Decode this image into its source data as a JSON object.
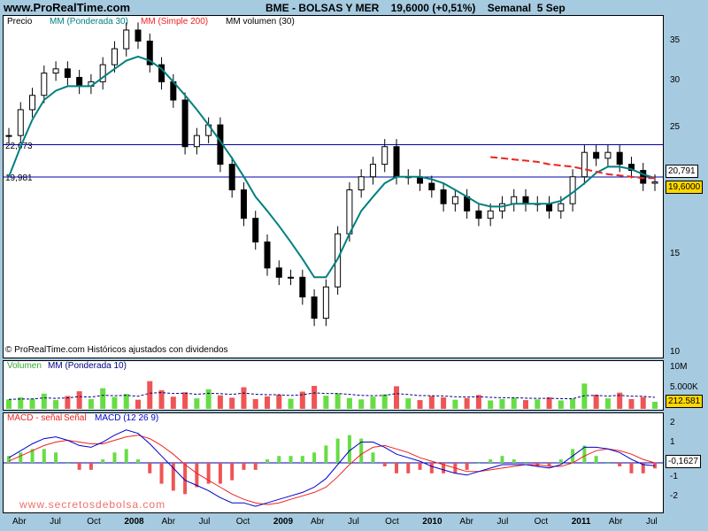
{
  "site": "www.ProRealTime.com",
  "header": {
    "instrument": "BME - BOLSAS Y MER",
    "price": "19,6000",
    "change": "(+0,51%)",
    "period": "Semanal  5 Sep"
  },
  "colors": {
    "background": "#a6cae0",
    "wma30": "#008080",
    "sma200": "#ee2222",
    "volume_up": "#66dd44",
    "volume_down": "#ee5555",
    "volume_ma": "#000080",
    "macd": "#0000cc",
    "signal": "#ee2222",
    "hline": "#0000aa"
  },
  "price_panel": {
    "legend": {
      "price": "Precio",
      "wma": "MM (Ponderada 30)",
      "sma": "MM (Simple 200)",
      "volma": "MM volumen (30)"
    },
    "copyright": "© ProRealTime.com Históricos ajustados con dividendos",
    "hlines": [
      {
        "label": "22,673",
        "value": 22.673
      },
      {
        "label": "19,981",
        "value": 19.981
      }
    ],
    "right_tags": {
      "ma": "20,791",
      "last": "19,6000"
    },
    "y_ticks": [
      "35",
      "30",
      "25",
      "20",
      "15",
      "10"
    ]
  },
  "volume_panel": {
    "legend_a": "Volumen",
    "legend_b": "MM (Ponderada 10)",
    "y_ticks": [
      "10M",
      "5.000K"
    ],
    "last_tag": "212.581"
  },
  "macd_panel": {
    "legend_a": "MACD - señal",
    "legend_b": "Señal",
    "legend_c": "MACD (12 26 9)",
    "y_ticks": [
      "2",
      "1",
      "-1",
      "-2"
    ],
    "zero_tick": "0",
    "last_tag": "-0,1627",
    "watermark": "www.secretosdebolsa.com"
  },
  "x_axis": [
    "Abr",
    "Jul",
    "Oct",
    "2008",
    "Abr",
    "Jul",
    "Oct",
    "2009",
    "Abr",
    "Jul",
    "Oct",
    "2010",
    "Abr",
    "Jul",
    "Oct",
    "2011",
    "Abr",
    "Jul"
  ],
  "chart_data": [
    {
      "type": "line",
      "series": [
        {
          "name": "Precio",
          "values": [
            23.5,
            26,
            27.5,
            30,
            30.5,
            29.5,
            28.5,
            29,
            31,
            33,
            35.5,
            34,
            31,
            29,
            27,
            22.5,
            23.5,
            24.5,
            21,
            19,
            17,
            15.5,
            14,
            13.5,
            13.5,
            12.5,
            11.5,
            13,
            16,
            19,
            20,
            21,
            22.5,
            20,
            20,
            19.5,
            19,
            18,
            18.5,
            17.5,
            17,
            17.5,
            18,
            18.5,
            18,
            18,
            17.5,
            18,
            20,
            22,
            21.5,
            22,
            21,
            20.5,
            19.5,
            19.6
          ]
        },
        {
          "name": "MM (Ponderada 30)",
          "values": [
            20,
            22.5,
            25,
            27,
            28,
            28.5,
            28.5,
            28.5,
            29.5,
            30.5,
            31.5,
            32,
            31.5,
            30.5,
            29,
            27.5,
            26,
            24.5,
            23,
            21.5,
            20,
            18.5,
            17.5,
            16.5,
            15.5,
            14.5,
            13.5,
            13.5,
            14.5,
            16,
            17.5,
            18.5,
            19.5,
            20,
            20,
            20,
            19.8,
            19.5,
            19,
            18.5,
            18,
            17.8,
            17.8,
            18,
            18,
            18,
            18,
            18.2,
            18.8,
            19.5,
            20.3,
            20.8,
            20.8,
            20.6,
            20.2,
            19.9
          ]
        },
        {
          "name": "MM (Simple 200)",
          "values": [
            null,
            null,
            null,
            null,
            null,
            null,
            null,
            null,
            null,
            null,
            null,
            null,
            null,
            null,
            null,
            null,
            null,
            null,
            null,
            null,
            null,
            null,
            null,
            null,
            null,
            null,
            null,
            null,
            null,
            null,
            null,
            null,
            null,
            null,
            null,
            null,
            null,
            null,
            null,
            null,
            null,
            21.6,
            21.5,
            21.4,
            21.3,
            21.2,
            21,
            20.9,
            20.8,
            20.6,
            20.4,
            20.2,
            20.1,
            20,
            19.9,
            19.9
          ]
        }
      ],
      "ylim": [
        10,
        37
      ],
      "log_scale": true,
      "grid": false
    },
    {
      "type": "bar",
      "series": [
        {
          "name": "Volumen",
          "values": [
            2.8,
            3.4,
            3.0,
            4.5,
            2.6,
            3.8,
            5.2,
            2.9,
            6.1,
            3.5,
            4.4,
            2.7,
            8.2,
            5.5,
            3.6,
            4.9,
            3.1,
            5.8,
            4.0,
            3.3,
            6.4,
            2.9,
            3.7,
            4.2,
            3.0,
            5.1,
            6.8,
            3.9,
            4.6,
            3.2,
            2.8,
            3.6,
            4.3,
            6.7,
            3.1,
            2.6,
            3.8,
            3.4,
            2.7,
            3.2,
            4.1,
            2.5,
            2.9,
            3.3,
            2.6,
            2.8,
            3.4,
            2.5,
            3.0,
            7.5,
            4.2,
            3.1,
            4.8,
            2.9,
            3.5,
            2.1
          ]
        }
      ],
      "ylim": [
        0,
        11
      ]
    },
    {
      "type": "line",
      "series": [
        {
          "name": "MACD (12 26 9)",
          "values": [
            0.3,
            0.7,
            1.1,
            1.4,
            1.5,
            1.3,
            1.0,
            0.9,
            1.2,
            1.6,
            1.9,
            1.7,
            1.1,
            0.4,
            -0.3,
            -1.0,
            -1.3,
            -1.6,
            -2.0,
            -2.3,
            -2.3,
            -2.5,
            -2.3,
            -2.1,
            -1.9,
            -1.7,
            -1.4,
            -0.9,
            -0.1,
            0.7,
            1.2,
            1.2,
            0.9,
            0.5,
            0.3,
            0.1,
            -0.2,
            -0.4,
            -0.6,
            -0.7,
            -0.5,
            -0.3,
            -0.1,
            -0.1,
            -0.1,
            -0.2,
            -0.3,
            -0.1,
            0.4,
            0.9,
            0.9,
            0.8,
            0.6,
            0.2,
            -0.1,
            -0.16
          ]
        },
        {
          "name": "Señal",
          "values": [
            0.1,
            0.4,
            0.7,
            1.0,
            1.2,
            1.3,
            1.2,
            1.1,
            1.1,
            1.3,
            1.5,
            1.6,
            1.4,
            1.0,
            0.5,
            -0.1,
            -0.6,
            -1.0,
            -1.4,
            -1.8,
            -2.1,
            -2.3,
            -2.4,
            -2.3,
            -2.1,
            -1.9,
            -1.7,
            -1.4,
            -0.8,
            -0.1,
            0.5,
            0.9,
            1.0,
            0.8,
            0.6,
            0.3,
            0.1,
            -0.1,
            -0.3,
            -0.5,
            -0.5,
            -0.4,
            -0.3,
            -0.2,
            -0.1,
            -0.1,
            -0.2,
            -0.2,
            0.0,
            0.4,
            0.7,
            0.8,
            0.7,
            0.5,
            0.2,
            0.0
          ]
        }
      ],
      "ylim": [
        -2.7,
        2.5
      ]
    }
  ]
}
